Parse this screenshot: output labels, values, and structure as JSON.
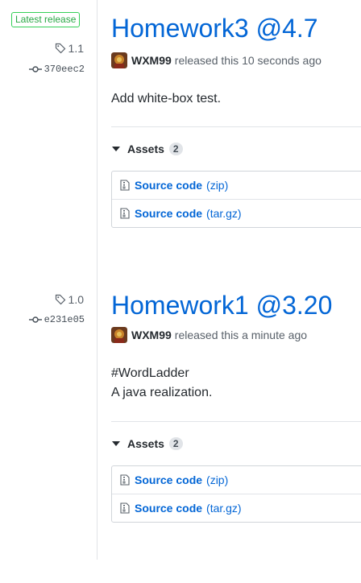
{
  "releases": [
    {
      "badge": "Latest release",
      "tag": "1.1",
      "commit": "370eec2",
      "title": "Homework3 @4.7",
      "author": "WXM99",
      "released_text": "released this 10 seconds ago",
      "body": [
        "Add white-box test."
      ],
      "assets_label": "Assets",
      "assets_count": "2",
      "assets": [
        {
          "label": "Source code",
          "ext": "(zip)"
        },
        {
          "label": "Source code",
          "ext": "(tar.gz)"
        }
      ]
    },
    {
      "tag": "1.0",
      "commit": "e231e05",
      "title": "Homework1 @3.20",
      "author": "WXM99",
      "released_text": "released this a minute ago",
      "body": [
        "#WordLadder",
        "A java realization."
      ],
      "assets_label": "Assets",
      "assets_count": "2",
      "assets": [
        {
          "label": "Source code",
          "ext": "(zip)"
        },
        {
          "label": "Source code",
          "ext": "(tar.gz)"
        }
      ]
    }
  ],
  "icons": {
    "tag": "tag-icon",
    "commit": "git-commit-icon",
    "file": "file-zip-icon",
    "caret": "triangle-down-icon"
  },
  "colors": {
    "link": "#0366d6",
    "badge": "#28a745"
  }
}
